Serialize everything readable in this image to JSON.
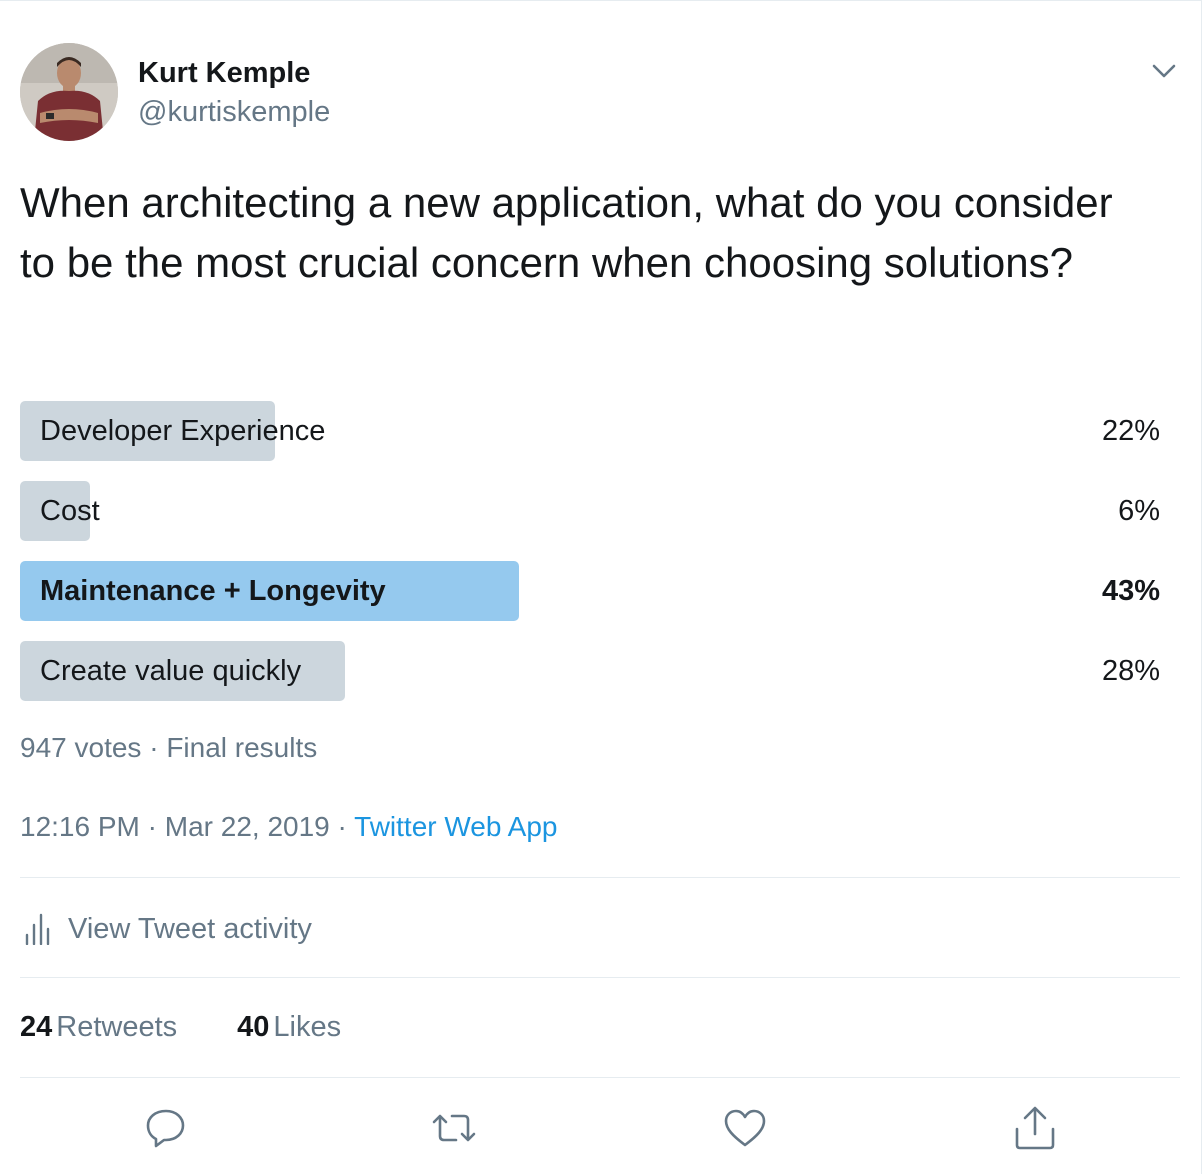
{
  "author": {
    "name": "Kurt Kemple",
    "handle": "@kurtiskemple"
  },
  "tweet": {
    "text": "When architecting a new application, what do you consider to be the most crucial concern when choosing solutions?"
  },
  "poll": {
    "options": [
      {
        "label": "Developer Experience",
        "percent_text": "22%",
        "percent": 22,
        "winner": false
      },
      {
        "label": "Cost",
        "percent_text": "6%",
        "percent": 6,
        "winner": false
      },
      {
        "label": "Maintenance + Longevity",
        "percent_text": "43%",
        "percent": 43,
        "winner": true
      },
      {
        "label": "Create value quickly",
        "percent_text": "28%",
        "percent": 28,
        "winner": false
      }
    ],
    "votes_text": "947 votes",
    "separator": "·",
    "status_text": "Final results"
  },
  "meta": {
    "time": "12:16 PM",
    "separator": "·",
    "date": "Mar 22, 2019",
    "source": "Twitter Web App"
  },
  "activity": {
    "label": "View Tweet activity",
    "icon": "bar-chart-icon"
  },
  "stats": {
    "retweets_count": "24",
    "retweets_label": "Retweets",
    "likes_count": "40",
    "likes_label": "Likes"
  },
  "actions": {
    "icons": [
      "reply-icon",
      "retweet-icon",
      "like-icon",
      "share-icon"
    ]
  },
  "colors": {
    "text_primary": "#14171a",
    "text_secondary": "#657786",
    "link": "#1b95e0",
    "poll_bar": "#ccd6dd",
    "poll_bar_winner": "#95c9ee",
    "divider": "#e6ecf0"
  }
}
